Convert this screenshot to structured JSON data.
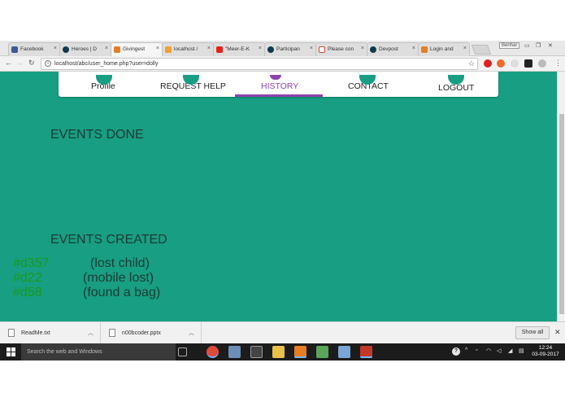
{
  "browser": {
    "tabs": [
      {
        "title": "Facebook",
        "icon": "facebook-icon",
        "color": "#3b5998",
        "active": false
      },
      {
        "title": "Heroes | D",
        "icon": "devpost-icon",
        "color": "#0e3b4b",
        "active": false
      },
      {
        "title": "Givingest",
        "icon": "codepen-icon",
        "color": "#e67e22",
        "active": true
      },
      {
        "title": "localhost /",
        "icon": "phpmyadmin-icon",
        "color": "#f0a030",
        "active": false
      },
      {
        "title": "\"Meer-E-K",
        "icon": "youtube-icon",
        "color": "#e62117",
        "active": false
      },
      {
        "title": "Participan",
        "icon": "devpost-icon",
        "color": "#0e3b4b",
        "active": false
      },
      {
        "title": "Please con",
        "icon": "gmail-icon",
        "color": "#d44638",
        "active": false
      },
      {
        "title": "Devpost",
        "icon": "devpost-icon",
        "color": "#0e3b4b",
        "active": false
      },
      {
        "title": "Login and",
        "icon": "codepen-icon",
        "color": "#e67e22",
        "active": false
      }
    ],
    "profile_label": "Benhar",
    "url": "localhost/abc/user_home.php?user=dolly"
  },
  "nav": {
    "items": [
      {
        "label": "Profile"
      },
      {
        "label": "REQUEST HELP"
      },
      {
        "label": "HISTORY",
        "active": true
      },
      {
        "label": "CONTACT"
      },
      {
        "label": "LOGOUT"
      }
    ]
  },
  "page": {
    "events_done_title": "EVENTS DONE",
    "events_created_title": "EVENTS CREATED",
    "events_created": [
      {
        "id": "#d357",
        "name": "(lost child)"
      },
      {
        "id": "#d22",
        "name": "(mobile lost)"
      },
      {
        "id": "#d58",
        "name": "(found a bag)"
      }
    ]
  },
  "downloads": {
    "items": [
      {
        "filename": "ReadMe.txt"
      },
      {
        "filename": "n00bcoder.pptx"
      }
    ],
    "show_all_label": "Show all"
  },
  "taskbar": {
    "search_placeholder": "Search the web and Windows",
    "time": "12:24",
    "date": "03-09-2017"
  },
  "colors": {
    "page_bg": "#179e83",
    "active_nav": "#8e44ad",
    "event_id": "#1a9a1a"
  }
}
